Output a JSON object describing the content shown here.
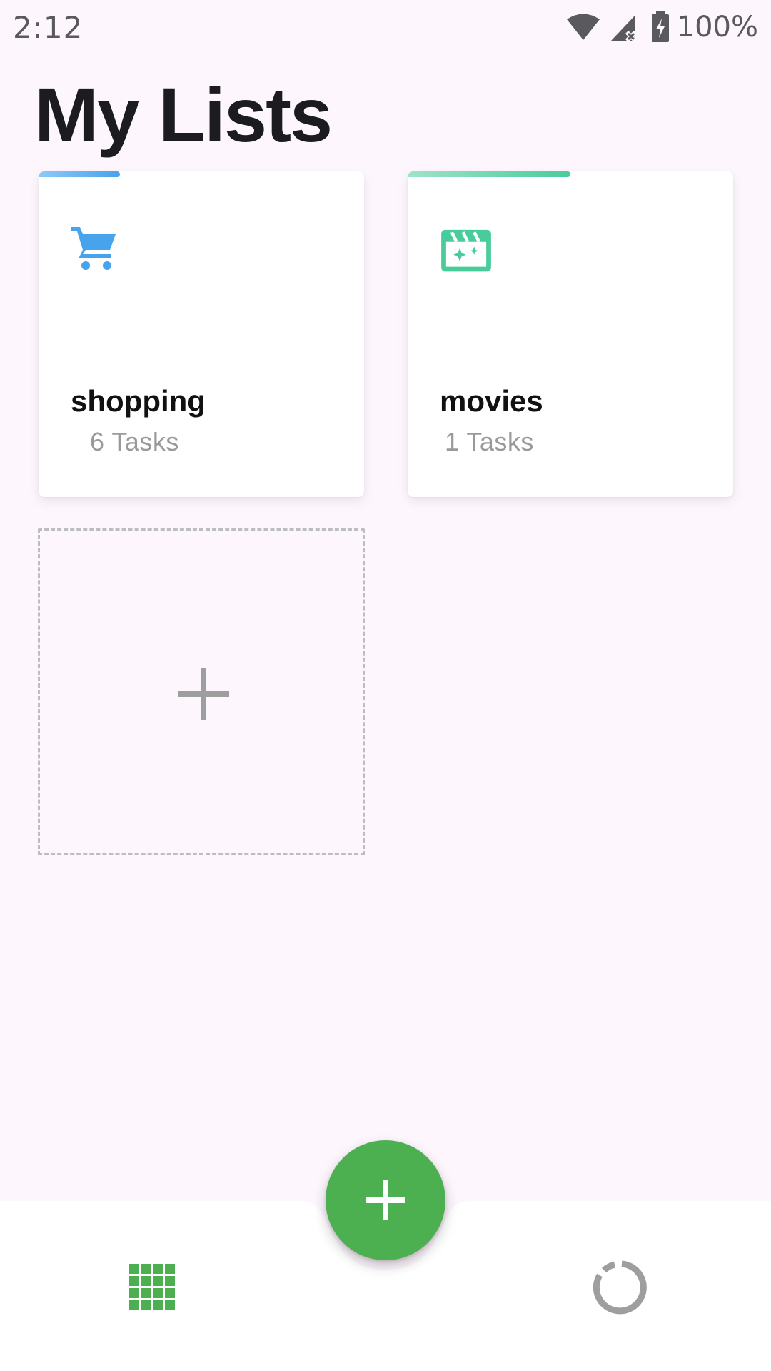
{
  "status_bar": {
    "time": "2:12",
    "battery": "100%",
    "icons": [
      "wifi-icon",
      "signal-icon",
      "battery-charging-icon"
    ]
  },
  "header": {
    "title": "My Lists"
  },
  "lists": [
    {
      "name": "shopping",
      "count": "6 Tasks",
      "icon": "cart-icon",
      "accent": "#46a3ec",
      "progress": 0.25
    },
    {
      "name": "movies",
      "count": "1 Tasks",
      "icon": "movie-icon",
      "accent": "#49cc9c",
      "progress": 0.5
    }
  ],
  "add_card": {
    "icon": "plus-icon"
  },
  "fab": {
    "icon": "plus-icon",
    "color": "#4caf50"
  },
  "bottom_nav": {
    "items": [
      {
        "icon": "grid-icon",
        "color": "#4caf50"
      },
      {
        "icon": "progress-ring-icon",
        "color": "#9e9e9e"
      }
    ]
  }
}
